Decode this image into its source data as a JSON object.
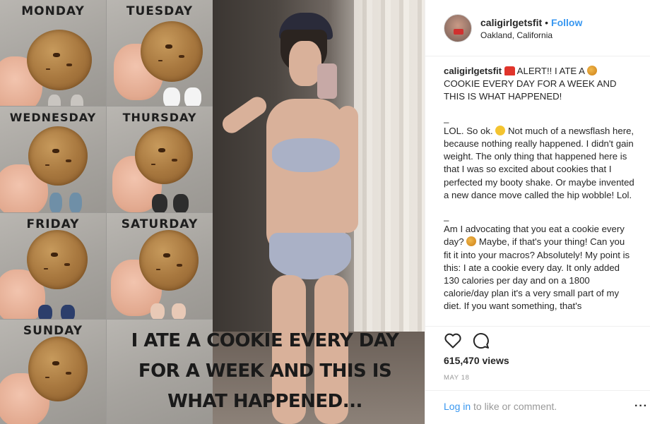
{
  "media": {
    "days": [
      "MONDAY",
      "TUESDAY",
      "WEDNESDAY",
      "THURSDAY",
      "FRIDAY",
      "SATURDAY",
      "SUNDAY"
    ],
    "overlay_lines": [
      "I ATE A COOKIE EVERY DAY",
      "FOR A WEEK AND THIS IS",
      "WHAT HAPPENED..."
    ]
  },
  "header": {
    "username": "caligirlgetsfit",
    "separator": "•",
    "follow_label": "Follow",
    "location": "Oakland, California"
  },
  "caption": {
    "username": "caligirlgetsfit",
    "lead": " ALERT!! I ATE A ",
    "lead_tail": " COOKIE EVERY DAY FOR A WEEK AND THIS IS WHAT HAPPENED!",
    "sep1": "_",
    "para2_a": "LOL. So ok. ",
    "para2_b": " Not much of a newsflash here, because nothing really happened. I didn't gain weight. The only thing that happened here is that I was so excited about cookies that I perfected my booty shake. Or maybe invented a new dance move called the hip wobble! Lol.",
    "sep2": "_",
    "para3_a": "Am I advocating that you eat a cookie every day? ",
    "para3_b": " Maybe, if that's your thing! Can you fit it into your macros? Absolutely! My point is this: I ate a cookie every day. It only added 130 calories per day and on a 1800 calorie/day plan it's a very small part of my diet. If you want something, that's"
  },
  "actions": {
    "like_icon": "heart-outline-icon",
    "comment_icon": "speech-bubble-icon"
  },
  "stats": {
    "views": "615,470 views",
    "date": "MAY 18"
  },
  "footer": {
    "login_link": "Log in",
    "login_text": " to like or comment.",
    "more_label": "···"
  },
  "colors": {
    "link_blue": "#3897f0",
    "text": "#262626",
    "muted": "#999999",
    "divider": "#efefef"
  }
}
